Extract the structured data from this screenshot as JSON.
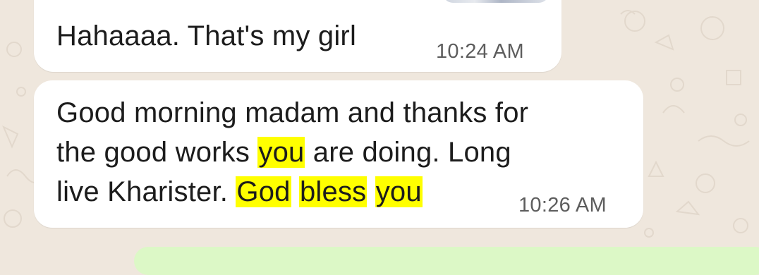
{
  "chat": {
    "messages": [
      {
        "direction": "incoming",
        "text_plain": "Hahaaaa. That's my girl",
        "time": "10:24 AM"
      },
      {
        "direction": "incoming",
        "line1": "Good morning madam and thanks for",
        "line2_a": "the good works ",
        "line2_hl": "you",
        "line2_b": " are doing. Long",
        "line3_a": "live Kharister. ",
        "line3_hl1": "God",
        "line3_sp1": " ",
        "line3_hl2": "bless",
        "line3_sp2": " ",
        "line3_hl3": "you",
        "time": "10:26 AM"
      }
    ]
  },
  "colors": {
    "wallpaper": "#efe7dd",
    "incoming_bubble": "#ffffff",
    "outgoing_bubble": "#dcf8c6",
    "highlight": "#ffff00",
    "timestamp": "#5d5d5d"
  },
  "icons": [
    "wallpaper-doodles"
  ]
}
